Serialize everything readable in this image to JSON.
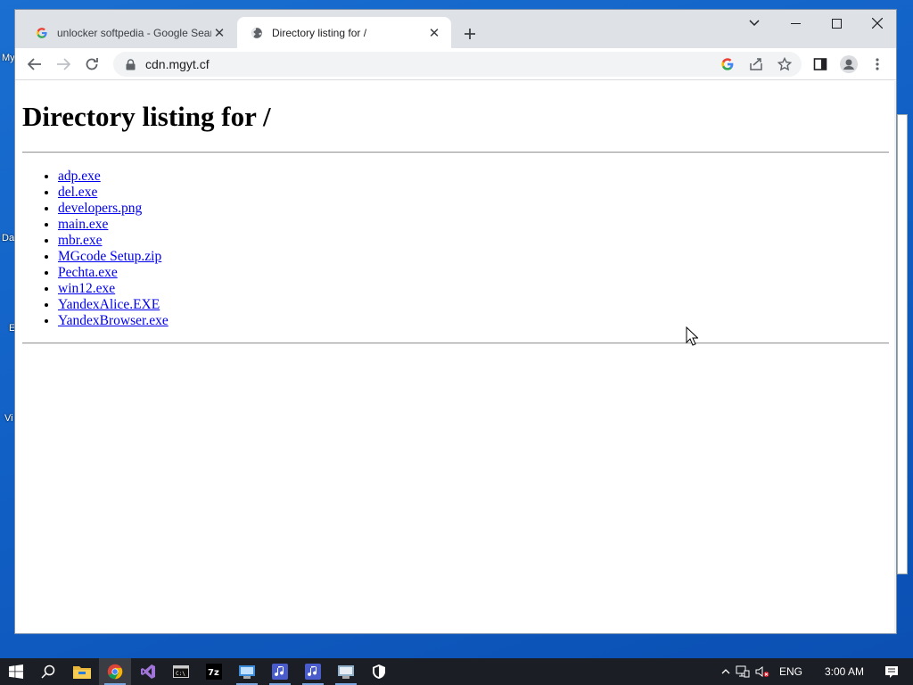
{
  "desktop": {
    "fragments": [
      "My",
      "Da",
      "E",
      "Vi"
    ]
  },
  "browser": {
    "tabs": [
      {
        "title": "unlocker softpedia - Google Search",
        "active": false,
        "icon": "google-g-icon"
      },
      {
        "title": "Directory listing for /",
        "active": true,
        "icon": "globe-icon"
      }
    ],
    "address": "cdn.mgyt.cf"
  },
  "page": {
    "heading": "Directory listing for /",
    "files": [
      "adp.exe",
      "del.exe",
      "developers.png",
      "main.exe",
      "mbr.exe",
      "MGcode Setup.zip",
      "Pechta.exe",
      "win12.exe",
      "YandexAlice.EXE",
      "YandexBrowser.exe"
    ]
  },
  "taskbar": {
    "apps": [
      "start-icon",
      "search-icon",
      "file-explorer-icon",
      "chrome-icon",
      "visual-studio-icon",
      "cmd-icon",
      "7zip-icon",
      "app-icon",
      "music-app-icon",
      "music-app-icon",
      "app-icon",
      "defender-icon"
    ],
    "tray": {
      "language": "ENG",
      "time": "3:00 AM"
    }
  },
  "colors": {
    "link": "#0000ee",
    "tabstrip": "#dee1e6",
    "taskbar": "#1b1e24"
  }
}
